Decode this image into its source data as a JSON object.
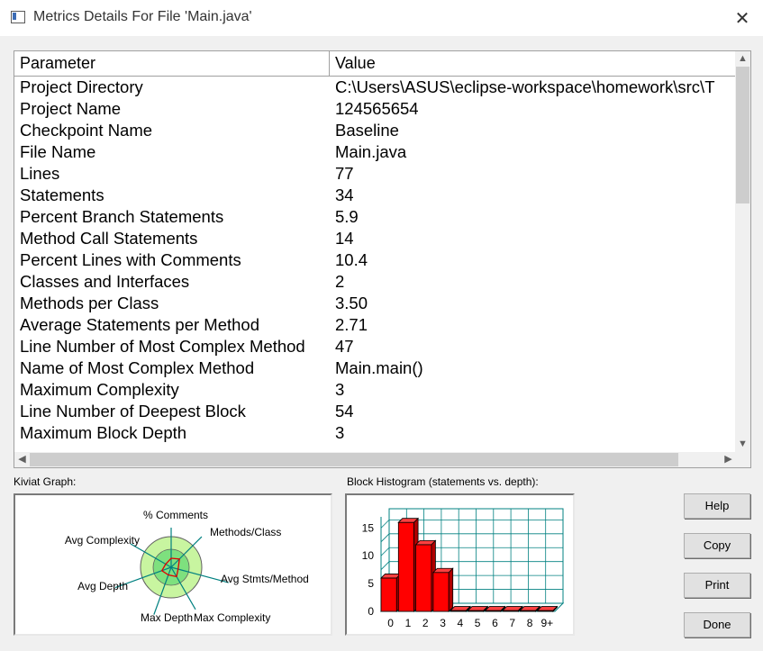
{
  "window": {
    "title": "Metrics Details For File 'Main.java'",
    "close_glyph": "✕"
  },
  "table": {
    "columns": [
      "Parameter",
      "Value"
    ],
    "rows": [
      {
        "parameter": "Project Directory",
        "value": "C:\\Users\\ASUS\\eclipse-workspace\\homework\\src\\T"
      },
      {
        "parameter": "Project Name",
        "value": "124565654"
      },
      {
        "parameter": "Checkpoint Name",
        "value": "Baseline"
      },
      {
        "parameter": "File Name",
        "value": "Main.java"
      },
      {
        "parameter": "Lines",
        "value": "77"
      },
      {
        "parameter": "Statements",
        "value": "34"
      },
      {
        "parameter": "Percent Branch Statements",
        "value": "5.9"
      },
      {
        "parameter": "Method Call Statements",
        "value": "14"
      },
      {
        "parameter": "Percent Lines with Comments",
        "value": "10.4"
      },
      {
        "parameter": "Classes and Interfaces",
        "value": "2"
      },
      {
        "parameter": "Methods per Class",
        "value": "3.50"
      },
      {
        "parameter": "Average Statements per Method",
        "value": "2.71"
      },
      {
        "parameter": "Line Number of Most Complex Method",
        "value": "47"
      },
      {
        "parameter": "Name of Most Complex Method",
        "value": "Main.main()"
      },
      {
        "parameter": "Maximum Complexity",
        "value": "3"
      },
      {
        "parameter": "Line Number of Deepest Block",
        "value": "54"
      },
      {
        "parameter": "Maximum Block Depth",
        "value": "3"
      }
    ]
  },
  "kiviat": {
    "label": "Kiviat Graph:",
    "axes": [
      "% Comments",
      "Methods/Class",
      "Avg Stmts/Method",
      "Max Complexity",
      "Max Depth",
      "Avg Depth",
      "Avg Complexity"
    ],
    "colors": {
      "outer": "#c8f5a0",
      "inner": "#7ee07e",
      "axis": "#008080",
      "plot": "#e00000"
    }
  },
  "histogram": {
    "label": "Block Histogram (statements vs. depth):",
    "bar_color": "#ff0000",
    "grid_color": "#008080"
  },
  "chart_data": {
    "type": "bar",
    "title": "Block Histogram (statements vs. depth):",
    "categories": [
      "0",
      "1",
      "2",
      "3",
      "4",
      "5",
      "6",
      "7",
      "8",
      "9+"
    ],
    "values": [
      6,
      16,
      12,
      7,
      0,
      0,
      0,
      0,
      0,
      0
    ],
    "ylim": [
      0,
      17
    ],
    "yticks": [
      0,
      5,
      10,
      15
    ],
    "grid": true
  },
  "buttons": {
    "help": "Help",
    "copy": "Copy",
    "print": "Print",
    "done": "Done"
  }
}
